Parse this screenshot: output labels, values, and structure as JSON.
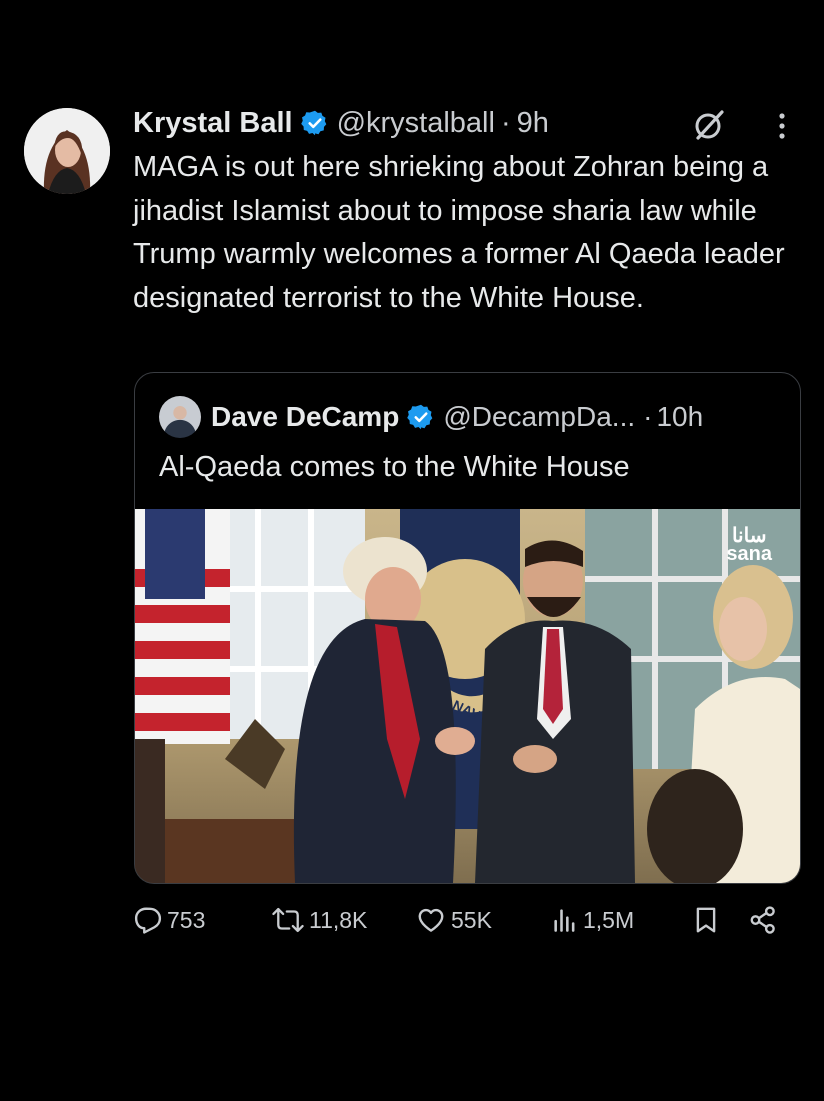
{
  "tweet": {
    "author_name": "Krystal Ball",
    "handle": "@krystalball",
    "separator": "·",
    "time": "9h",
    "text": "MAGA is out here shrieking about Zohran being a jihadist Islamist about to impose sharia law while Trump warmly welcomes a former Al Qaeda leader designated terrorist to the White House."
  },
  "quote": {
    "author_name": "Dave DeCamp",
    "handle": "@DecampDa...",
    "separator": "·",
    "time": "10h",
    "text": "Al-Qaeda comes to the White House",
    "image": {
      "watermark_arabic": "سانا",
      "watermark_latin": "sana",
      "seal_text": "ES NAVY"
    }
  },
  "actions": {
    "replies": "753",
    "reposts": "11,8K",
    "likes": "55K",
    "views": "1,5M"
  },
  "colors": {
    "background": "#000000",
    "text": "#e7e9ea",
    "secondary": "#c9ccd0",
    "verified": "#1d9bf0",
    "border": "#3a3d42"
  },
  "icons": [
    "verified-badge-icon",
    "grok-icon",
    "more-icon",
    "reply-icon",
    "repost-icon",
    "like-icon",
    "views-icon",
    "bookmark-icon",
    "share-icon"
  ]
}
